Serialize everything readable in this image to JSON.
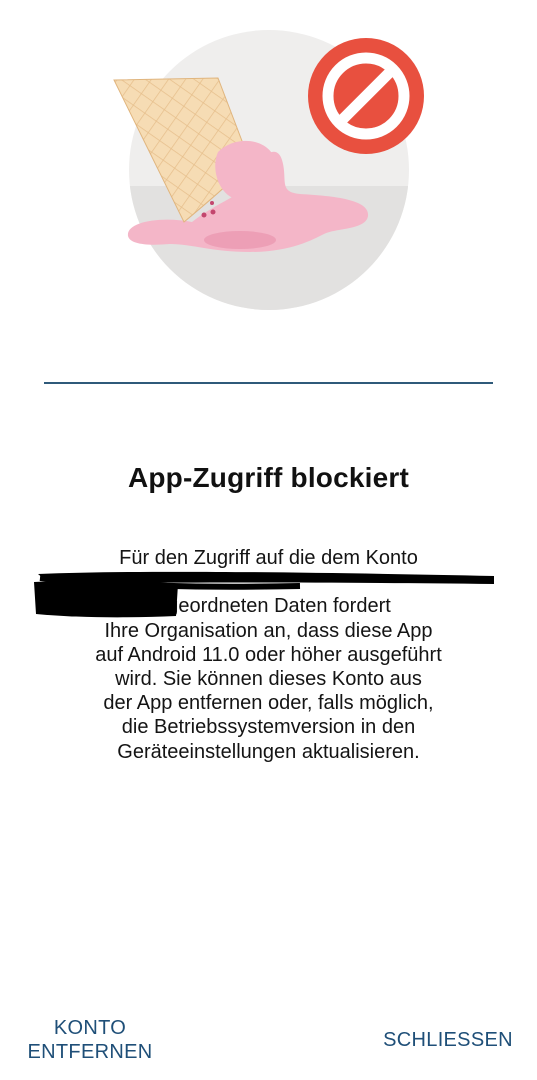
{
  "dialog": {
    "title": "App-Zugriff blockiert",
    "message_lines": [
      "Für den Zugriff auf die dem Konto",
      "",
      "zugeordneten Daten fordert",
      "Ihre Organisation an, dass diese App",
      "auf Android 11.0 oder höher ausgeführt",
      "wird. Sie können dieses Konto aus",
      "der App entfernen oder, falls möglich,",
      "die Betriebssystemversion in den",
      "Geräteeinstellungen aktualisieren."
    ]
  },
  "actions": {
    "remove_account_line1": "KONTO",
    "remove_account_line2": "ENTFERNEN",
    "close_label": "SCHLIESSEN"
  },
  "colors": {
    "accent": "#1f4f78",
    "blocked_badge": "#e8503f",
    "divider": "#2f5a7a"
  },
  "icons": {
    "illustration": "melted-ice-cream-illustration",
    "blocked": "blocked-icon"
  }
}
